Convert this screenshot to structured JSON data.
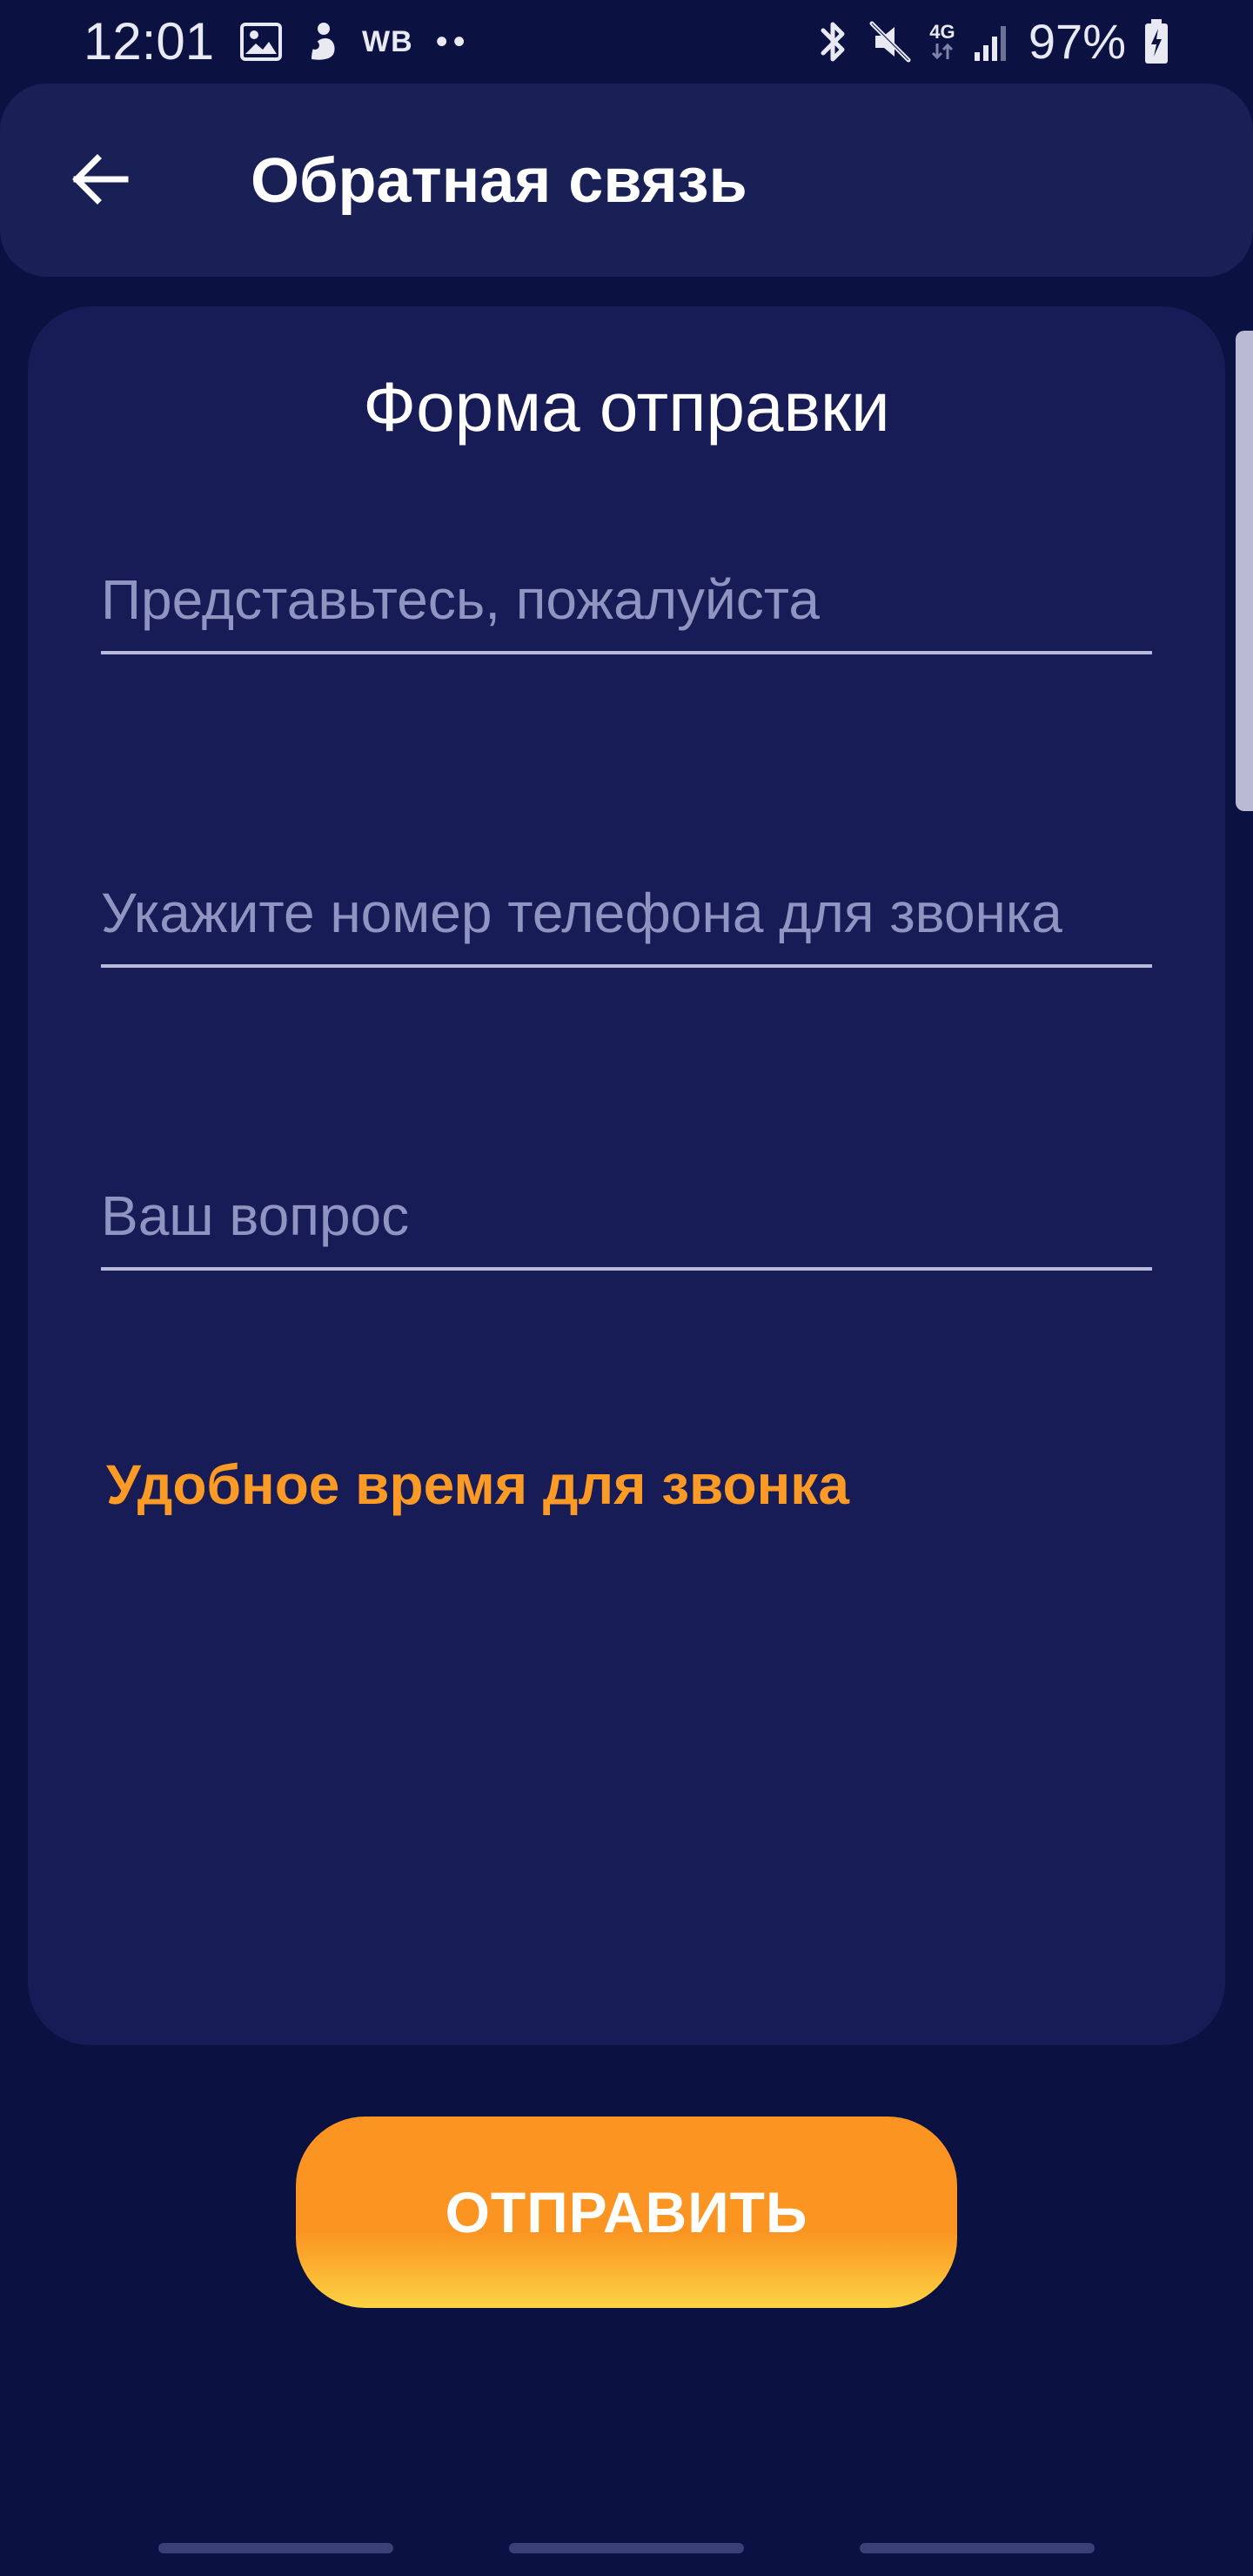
{
  "status_bar": {
    "time": "12:01",
    "left_icons": [
      "image-icon",
      "notification-app-icon"
    ],
    "wb_label": "WB",
    "more_dots": "••",
    "right_icons": [
      "bluetooth-icon",
      "mute-icon",
      "network-4g-icon",
      "signal-icon",
      "battery-charging-icon"
    ],
    "network_label": "4G",
    "battery": "97%"
  },
  "app_bar": {
    "title": "Обратная связь",
    "back_icon": "arrow-left-icon"
  },
  "form": {
    "title": "Форма отправки",
    "fields": {
      "name": {
        "value": "",
        "placeholder": "Представьтесь, пожалуйста"
      },
      "phone": {
        "value": "",
        "placeholder": "Укажите номер телефона для звонка"
      },
      "question": {
        "value": "",
        "placeholder": "Ваш вопрос"
      }
    },
    "call_time_label": "Удобное время для звонка"
  },
  "submit": {
    "label": "ОТПРАВИТЬ"
  },
  "colors": {
    "background": "#0b1140",
    "card": "#171c56",
    "app_bar": "#182056",
    "accent_orange": "#fb9a24",
    "button_gradient_top": "#fb9421",
    "button_gradient_bottom": "#fcd343",
    "placeholder": "#8f94c0",
    "underline": "#b7badb"
  }
}
